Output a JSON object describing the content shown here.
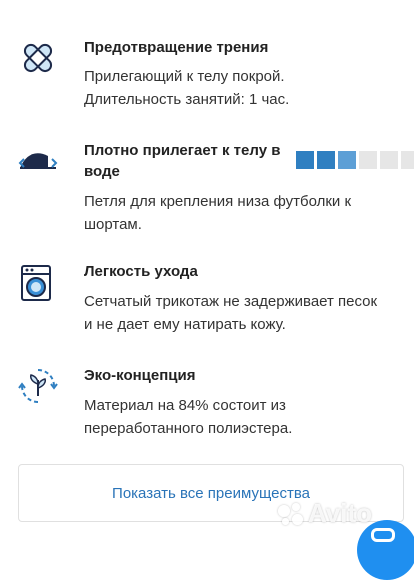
{
  "colors": {
    "accent": "#2f7fc1",
    "link": "#2a74b8",
    "fab": "#1f8ff0"
  },
  "features": [
    {
      "icon": "band-aid-icon",
      "title": "Предотвращение трения",
      "desc_lines": [
        "Прилегающий к телу покрой.",
        "Длительность занятий: 1 час."
      ]
    },
    {
      "icon": "fit-icon",
      "title_lines": [
        "Плотно прилегает к телу в",
        "воде"
      ],
      "rating": {
        "value": 2,
        "max": 6
      },
      "desc_lines": [
        "Петля для крепления низа футболки к",
        "шортам."
      ]
    },
    {
      "icon": "washing-machine-icon",
      "title": "Легкость ухода",
      "desc_lines": [
        "Сетчатый трикотаж не задерживает песок",
        "и не дает ему натирать кожу."
      ]
    },
    {
      "icon": "eco-leaf-icon",
      "title": "Эко-концепция",
      "desc_lines": [
        "Материал на 84% состоит из",
        "переработанного полиэстера."
      ]
    }
  ],
  "show_all_button": "Показать все преимущества",
  "watermark": "Avito"
}
